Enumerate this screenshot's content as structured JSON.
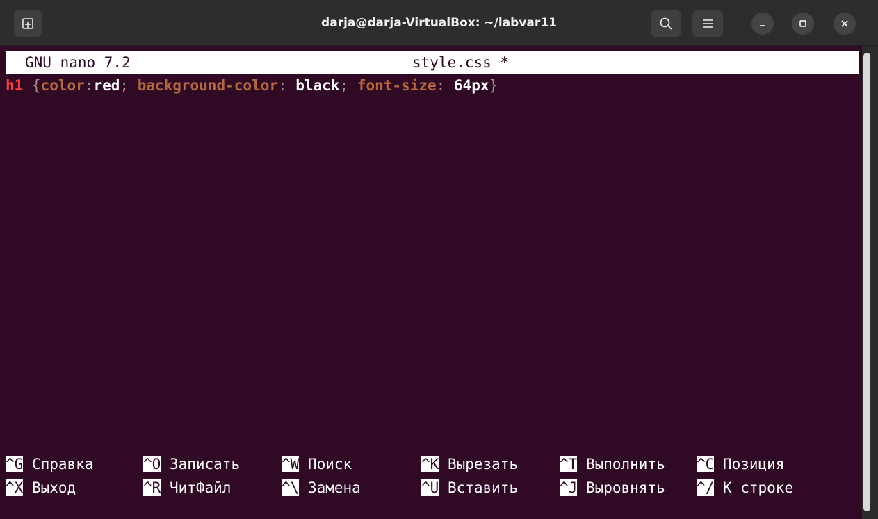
{
  "window": {
    "title": "darja@darja-VirtualBox: ~/labvar11"
  },
  "nano": {
    "app": "GNU nano 7.2",
    "filename": "style.css *"
  },
  "code": {
    "selector": "h1",
    "open": " {",
    "prop1": "color",
    "colon1": ":",
    "val1": "red",
    "semi1": "; ",
    "prop2": "background-color",
    "colon2": ": ",
    "val2": "black",
    "semi2": "; ",
    "prop3": "font-size",
    "colon3": ": ",
    "val3": "64px",
    "close": "}"
  },
  "shortcuts": [
    {
      "key": "^G",
      "label": "Справка"
    },
    {
      "key": "^O",
      "label": "Записать"
    },
    {
      "key": "^W",
      "label": "Поиск"
    },
    {
      "key": "^K",
      "label": "Вырезать"
    },
    {
      "key": "^T",
      "label": "Выполнить"
    },
    {
      "key": "^C",
      "label": "Позиция"
    },
    {
      "key": "^X",
      "label": "Выход"
    },
    {
      "key": "^R",
      "label": "ЧитФайл"
    },
    {
      "key": "^\\",
      "label": "Замена"
    },
    {
      "key": "^U",
      "label": "Вставить"
    },
    {
      "key": "^J",
      "label": "Выровнять"
    },
    {
      "key": "^/",
      "label": "К строке"
    }
  ],
  "colors": {
    "background": "#300a24",
    "selector": "#ff3b3b",
    "property": "#b3683d",
    "punctuation": "#a48d86"
  },
  "icons": {
    "new_tab": "new-tab-icon",
    "search": "search-icon",
    "menu": "hamburger-menu-icon",
    "minimize": "minimize-icon",
    "maximize": "maximize-icon",
    "close": "close-icon"
  }
}
